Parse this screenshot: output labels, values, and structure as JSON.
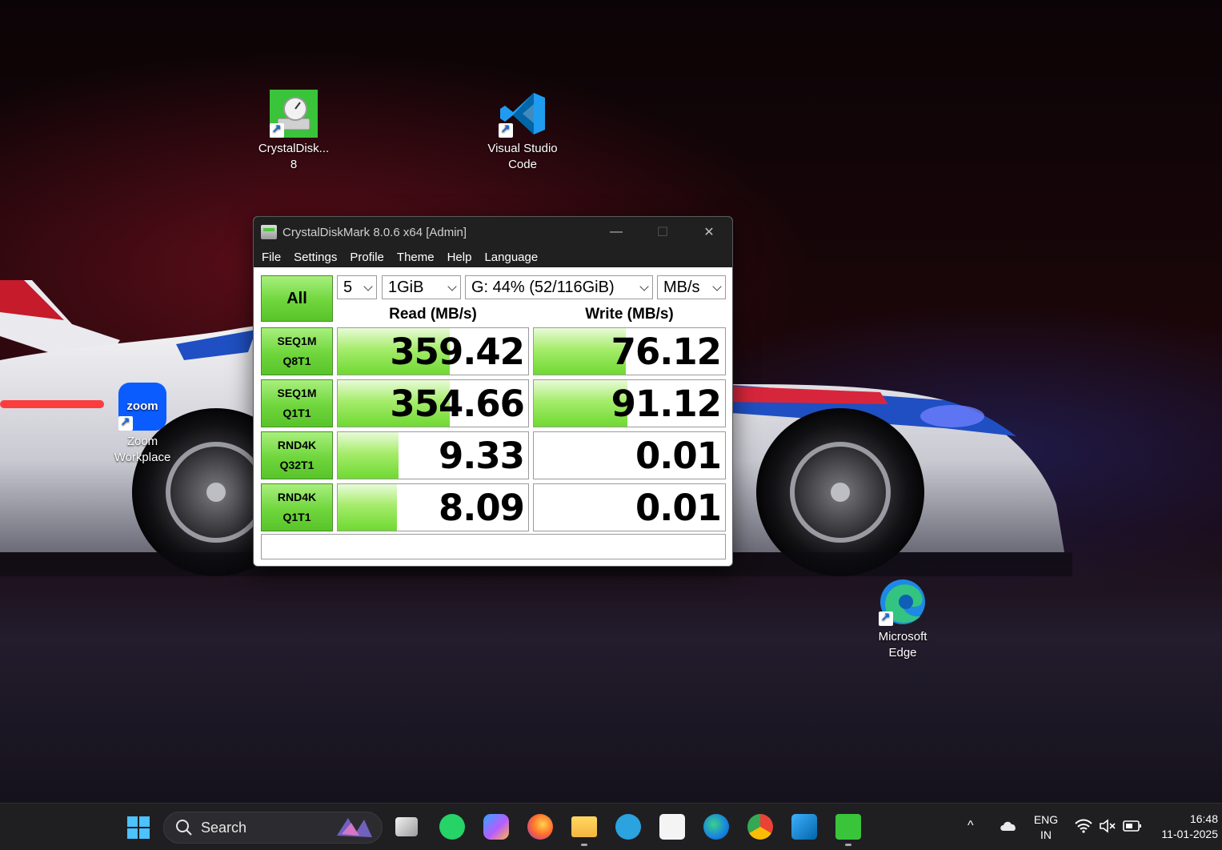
{
  "desktop": {
    "icons": [
      {
        "label": "CrystalDisk... 8",
        "icon": "crystaldiskmark-icon"
      },
      {
        "label": "Visual Studio Code",
        "icon": "vscode-icon"
      },
      {
        "label": "Zoom Workplace",
        "icon": "zoom-icon",
        "badge": "zoom"
      },
      {
        "label": "Microsoft Edge",
        "icon": "edge-icon"
      }
    ]
  },
  "window": {
    "title": "CrystalDiskMark 8.0.6 x64 [Admin]",
    "controls": {
      "minimize": "—",
      "maximize": "☐",
      "close": "✕"
    },
    "menu": [
      "File",
      "Settings",
      "Profile",
      "Theme",
      "Help",
      "Language"
    ],
    "all_button": "All",
    "count_select": "5",
    "size_select": "1GiB",
    "drive_select": "G: 44% (52/116GiB)",
    "unit_select": "MB/s",
    "read_header": "Read (MB/s)",
    "write_header": "Write (MB/s)",
    "rows": [
      {
        "line1": "SEQ1M",
        "line2": "Q8T1",
        "read": "359.42",
        "write": "76.12",
        "read_fill": 0.59,
        "write_fill": 0.48
      },
      {
        "line1": "SEQ1M",
        "line2": "Q1T1",
        "read": "354.66",
        "write": "91.12",
        "read_fill": 0.59,
        "write_fill": 0.49
      },
      {
        "line1": "RND4K",
        "line2": "Q32T1",
        "read": "9.33",
        "write": "0.01",
        "read_fill": 0.32,
        "write_fill": 0.0
      },
      {
        "line1": "RND4K",
        "line2": "Q1T1",
        "read": "8.09",
        "write": "0.01",
        "read_fill": 0.31,
        "write_fill": 0.0
      }
    ],
    "comment": ""
  },
  "taskbar": {
    "search_label": "Search",
    "apps": [
      "task-view-icon",
      "whatsapp-icon",
      "copilot-icon",
      "firefox-icon",
      "file-explorer-icon",
      "telegram-icon",
      "microsoft-store-icon",
      "edge-icon",
      "chrome-icon",
      "vscode-icon",
      "crystaldiskmark-icon"
    ],
    "tray": {
      "chevron": "^",
      "language_line1": "ENG",
      "language_line2": "IN",
      "time": "16:48",
      "date": "11-01-2025"
    }
  },
  "colors": {
    "titlebar": "#202020",
    "bar_green": "#6fd932",
    "button_green": "#58c42a"
  }
}
